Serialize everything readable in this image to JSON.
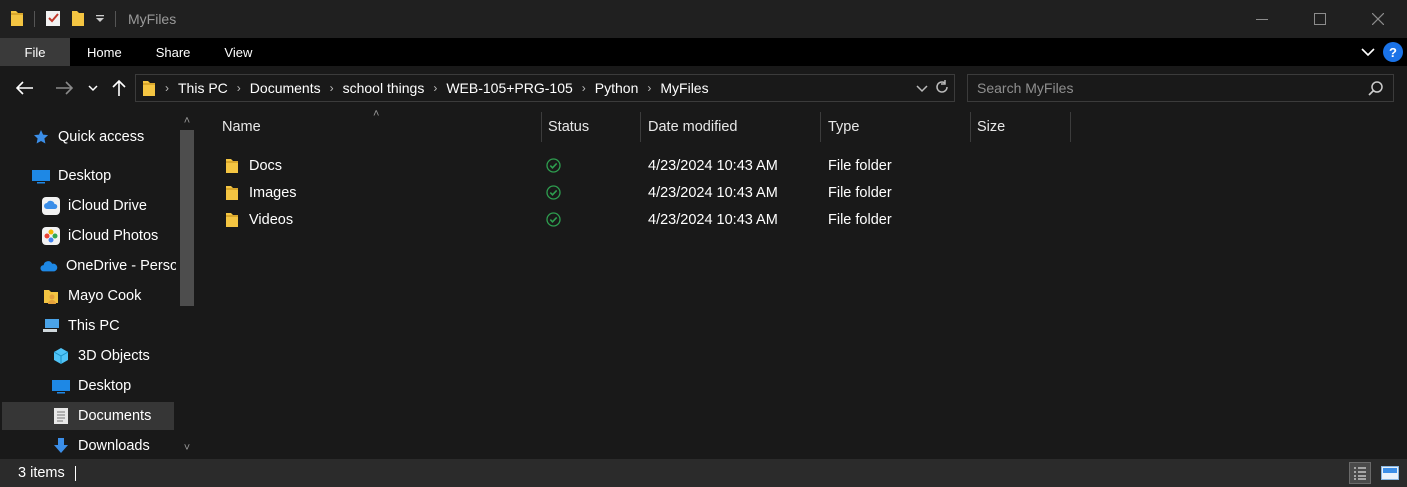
{
  "window": {
    "title": "MyFiles"
  },
  "ribbon": {
    "tabs": [
      "File",
      "Home",
      "Share",
      "View"
    ],
    "help": "?"
  },
  "address": {
    "breadcrumbs": [
      "This PC",
      "Documents",
      "school things",
      "WEB-105+PRG-105",
      "Python",
      "MyFiles"
    ]
  },
  "search": {
    "placeholder": "Search MyFiles"
  },
  "navpane": {
    "items": [
      {
        "label": "Quick access",
        "icon": "star-icon"
      },
      {
        "label": "Desktop",
        "icon": "desktop-icon"
      },
      {
        "label": "iCloud Drive",
        "icon": "icloud-drive-icon"
      },
      {
        "label": "iCloud Photos",
        "icon": "icloud-photos-icon"
      },
      {
        "label": "OneDrive - Personal",
        "icon": "onedrive-icon"
      },
      {
        "label": "Mayo Cook",
        "icon": "user-folder-icon"
      },
      {
        "label": "This PC",
        "icon": "this-pc-icon"
      },
      {
        "label": "3D Objects",
        "icon": "3d-objects-icon"
      },
      {
        "label": "Desktop",
        "icon": "desktop-icon"
      },
      {
        "label": "Documents",
        "icon": "documents-icon"
      },
      {
        "label": "Downloads",
        "icon": "downloads-icon"
      }
    ]
  },
  "columns": {
    "name": "Name",
    "status": "Status",
    "date": "Date modified",
    "type": "Type",
    "size": "Size"
  },
  "files": [
    {
      "name": "Docs",
      "date": "4/23/2024 10:43 AM",
      "type": "File folder",
      "size": ""
    },
    {
      "name": "Images",
      "date": "4/23/2024 10:43 AM",
      "type": "File folder",
      "size": ""
    },
    {
      "name": "Videos",
      "date": "4/23/2024 10:43 AM",
      "type": "File folder",
      "size": ""
    }
  ],
  "status": {
    "item_count": "3 items"
  },
  "colors": {
    "folder": "#f4c542",
    "accent_blue": "#1a73e8",
    "synced_green": "#2e9e4f"
  }
}
